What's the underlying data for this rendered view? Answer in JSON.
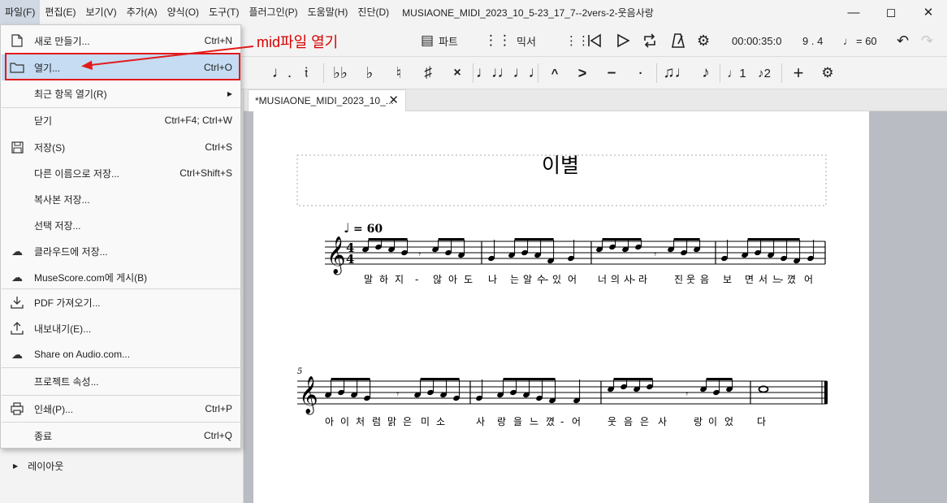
{
  "menubar": {
    "items": [
      "파일(F)",
      "편집(E)",
      "보기(V)",
      "추가(A)",
      "양식(O)",
      "도구(T)",
      "플러그인(P)",
      "도움말(H)",
      "진단(D)"
    ],
    "window_title": "MUSIAONE_MIDI_2023_10_5-23_17_7--2vers-2-웃음사랑",
    "window_buttons": [
      "minimize",
      "maximize",
      "close"
    ]
  },
  "toolbar": {
    "parts_label": "파트",
    "mixer_label": "믹서",
    "time": "00:00:35:0",
    "position": "9 . 4",
    "tempo": "= 60"
  },
  "note_toolbar": {
    "icons": [
      "dotted-quarter-note-icon",
      "quarter-rest-icon",
      "double-flat-icon",
      "flat-icon",
      "natural-icon",
      "sharp-icon",
      "double-sharp-icon",
      "tie-icon",
      "slur-icon",
      "marcato-icon",
      "accent-icon",
      "tenuto-icon",
      "staccato-icon",
      "tuplet-icon",
      "flip-direction-icon",
      "voice-1-icon",
      "voice-2-icon",
      "add-icon",
      "settings-icon"
    ]
  },
  "tab": {
    "label": "*MUSIAONE_MIDI_2023_10_...",
    "close_glyph": "✕"
  },
  "left_panel": {
    "layout_label": "레이아웃"
  },
  "file_menu": {
    "items": [
      {
        "icon": "new-file-icon",
        "label": "새로 만들기...",
        "shortcut": "Ctrl+N"
      },
      {
        "icon": "folder-icon",
        "label": "열기...",
        "shortcut": "Ctrl+O",
        "highlighted": true
      },
      {
        "icon": "",
        "label": "최근 항목 열기(R)",
        "shortcut": "",
        "submenu": true
      },
      {
        "icon": "",
        "label": "닫기",
        "shortcut": "Ctrl+F4; Ctrl+W"
      },
      {
        "icon": "save-icon",
        "label": "저장(S)",
        "shortcut": "Ctrl+S"
      },
      {
        "icon": "",
        "label": "다른 이름으로 저장...",
        "shortcut": "Ctrl+Shift+S"
      },
      {
        "icon": "",
        "label": "복사본 저장...",
        "shortcut": ""
      },
      {
        "icon": "",
        "label": "선택 저장...",
        "shortcut": ""
      },
      {
        "icon": "cloud-upload-icon",
        "label": "클라우드에 저장...",
        "shortcut": ""
      },
      {
        "icon": "cloud-upload-icon",
        "label": "MuseScore.com에 게시(B)",
        "shortcut": ""
      },
      {
        "icon": "import-icon",
        "label": "PDF 가져오기...",
        "shortcut": ""
      },
      {
        "icon": "export-icon",
        "label": "내보내기(E)...",
        "shortcut": ""
      },
      {
        "icon": "cloud-share-icon",
        "label": "Share on Audio.com...",
        "shortcut": ""
      },
      {
        "icon": "",
        "label": "프로젝트 속성...",
        "shortcut": ""
      },
      {
        "icon": "print-icon",
        "label": "인쇄(P)...",
        "shortcut": "Ctrl+P"
      },
      {
        "icon": "",
        "label": "종료",
        "shortcut": "Ctrl+Q"
      }
    ]
  },
  "annotation": {
    "text": "mid파일 열기",
    "color": "#d80000"
  },
  "score": {
    "title": "이별",
    "tempo_mark": "= 60",
    "time_signature": "4/4",
    "measure_number_line2": "5",
    "lyrics_line1": [
      "말",
      "하",
      "지",
      "-",
      "않",
      "아",
      "도",
      "나",
      "는",
      "알",
      "수",
      "-",
      "있",
      "어",
      "너",
      "의",
      "사",
      "-",
      "라",
      "진",
      "웃",
      "음",
      "보",
      "면",
      "서",
      "느",
      "-",
      "꼈",
      "어"
    ],
    "lyrics_line2": [
      "아",
      "이",
      "처",
      "럼",
      "맑",
      "은",
      "미",
      "소",
      "사",
      "랑",
      "을",
      "느",
      "꼈",
      "-",
      "어",
      "웃",
      "음",
      "은",
      "사",
      "랑",
      "이",
      "었",
      "다"
    ]
  }
}
